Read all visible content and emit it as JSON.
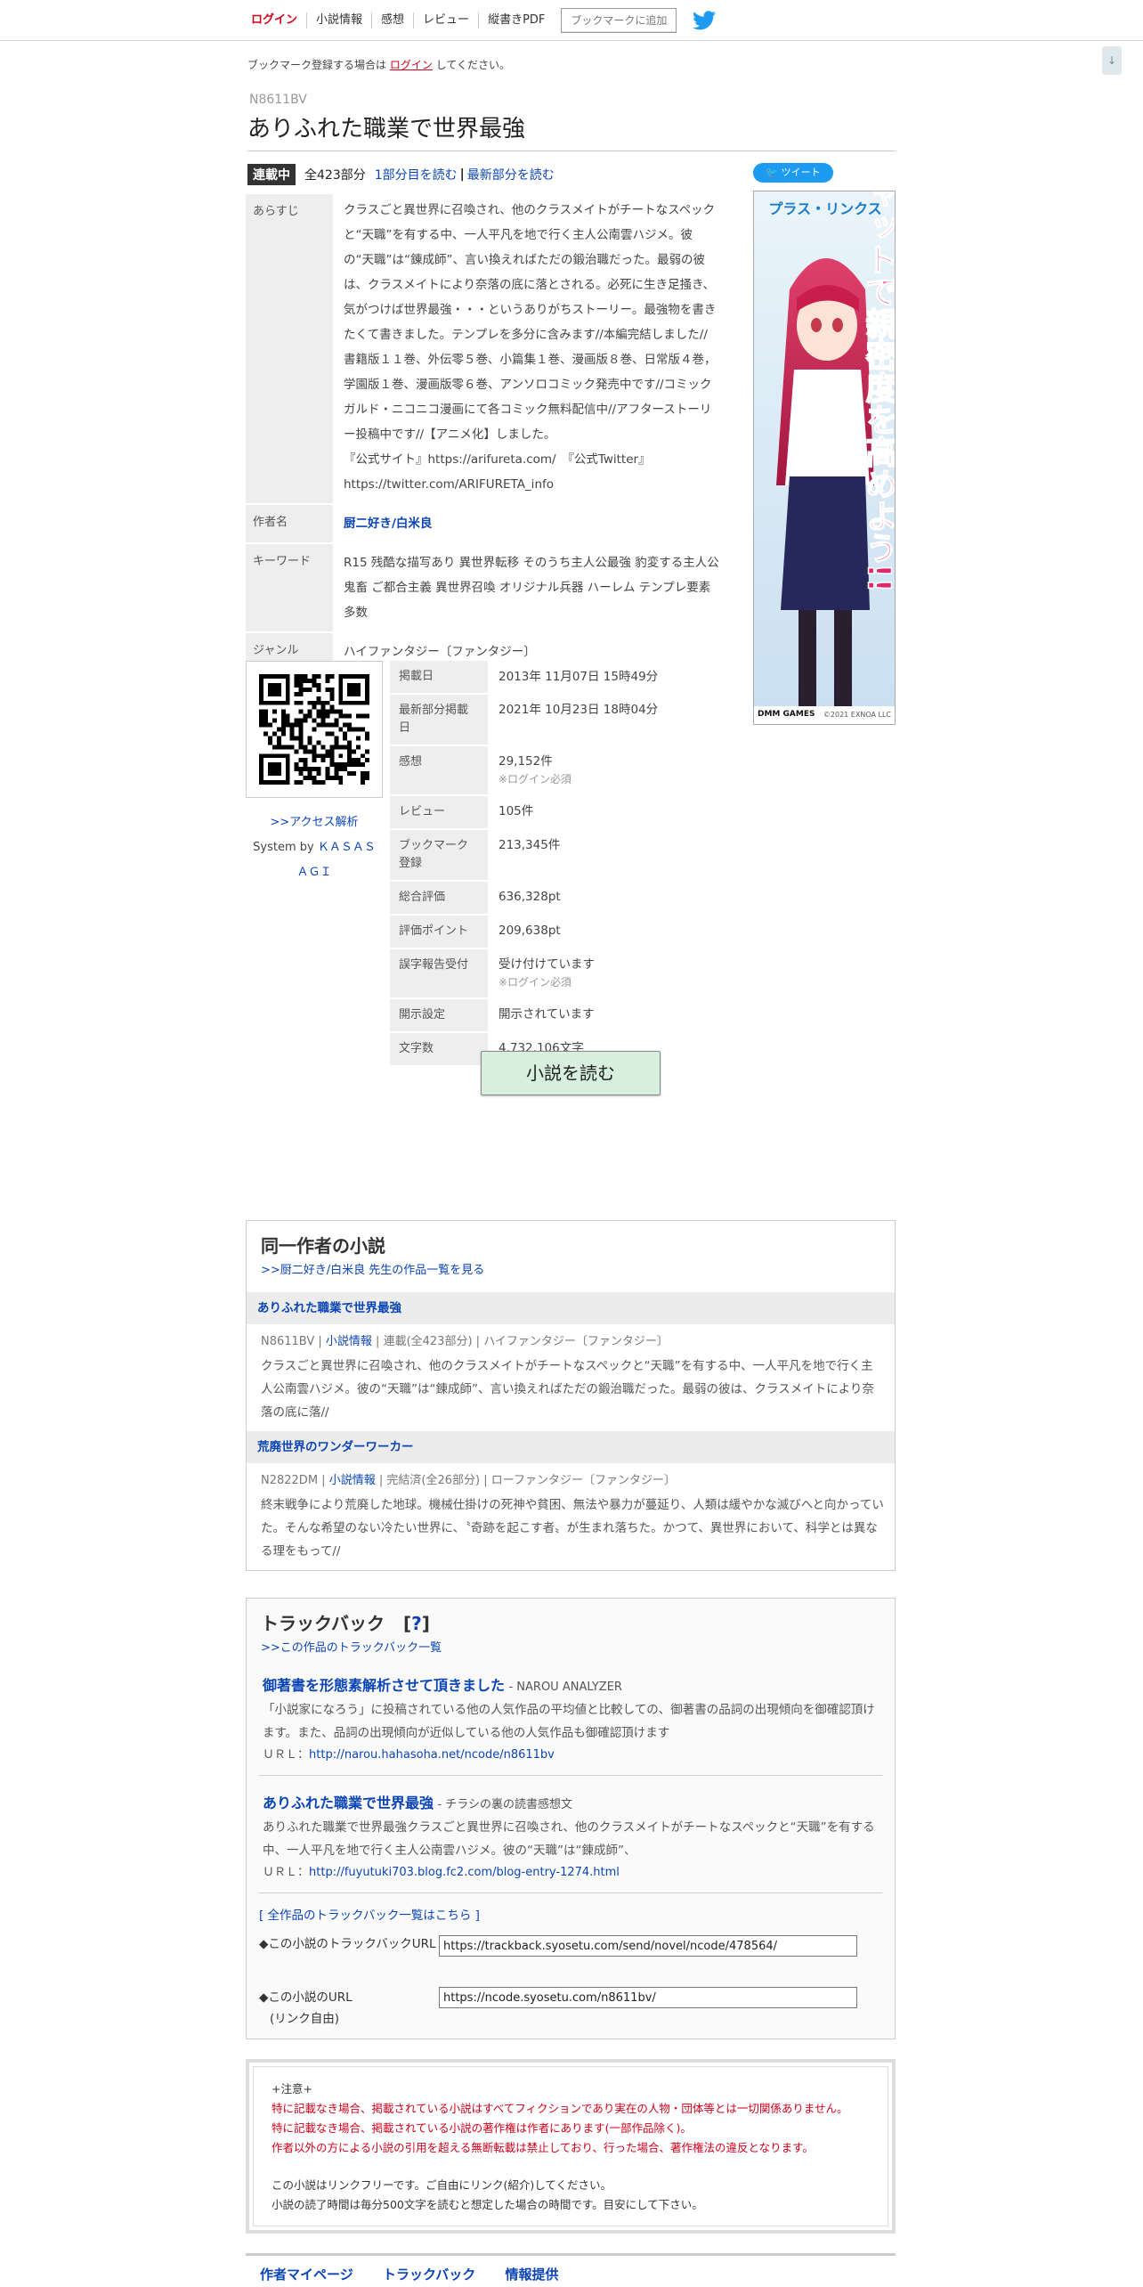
{
  "nav": {
    "login": "ログイン",
    "items": [
      "小説情報",
      "感想",
      "レビュー",
      "縦書きPDF"
    ],
    "bookmark_button": "ブックマークに追加",
    "scroll_arrow": "↓"
  },
  "notice": {
    "prefix": "ブックマーク登録する場合は",
    "login": "ログイン",
    "suffix": "してください。"
  },
  "ncode": "N8611BV",
  "title": "ありふれた職業で世界最強",
  "status": {
    "badge": "連載中",
    "total": "全423部分",
    "read_first": "1部分目を読む",
    "separator": "|",
    "read_latest": "最新部分を読む"
  },
  "info": {
    "synopsis_label": "あらすじ",
    "synopsis_lines": [
      "クラスごと異世界に召喚され、他のクラスメイトがチートなスペックと“天職”を有する中、一人平凡を地で行く主人公南雲ハジメ。彼の“天職”は“錬成師”、言い換えればただの鍛治職だった。最弱の彼は、クラスメイトにより奈落の底に落とされる。必死に生き足掻き、気がつけば世界最強・・・というありがちストーリー。最強物を書きたくて書きました。テンプレを多分に含みます//本編完結しました//書籍版１１巻、外伝零５巻、小篇集１巻、漫画版８巻、日常版４巻，学園版１巻、漫画版零６巻、アンソロコミック発売中です//コミックガルド・ニコニコ漫画にて各コミック無料配信中//アフターストーリー投稿中です//【アニメ化】しました。",
      "『公式サイト』https://arifureta.com/　『公式Twitter』",
      "https://twitter.com/ARIFURETA_info"
    ],
    "author_label": "作者名",
    "author": "厨二好き/白米良",
    "keyword_label": "キーワード",
    "keywords": "R15 残酷な描写あり 異世界転移 そのうち主人公最強 豹変する主人公 鬼畜 ご都合主義 異世界召喚 オリジナル兵器 ハーレム テンプレ要素多数",
    "genre_label": "ジャンル",
    "genre": "ハイファンタジー〔ファンタジー〕"
  },
  "access": {
    "link": ">>アクセス解析",
    "system_prefix": "System by",
    "system_name_1": "ＫＡＳＡＳ",
    "system_name_2": "ＡＧＩ"
  },
  "stats": [
    {
      "label": "掲載日",
      "value": "2013年 11月07日 15時49分",
      "note": ""
    },
    {
      "label": "最新部分掲載日",
      "value": "2021年 10月23日 18時04分",
      "note": ""
    },
    {
      "label": "感想",
      "value": "29,152件",
      "note": "※ログイン必須"
    },
    {
      "label": "レビュー",
      "value": "105件",
      "note": ""
    },
    {
      "label": "ブックマーク登録",
      "value": "213,345件",
      "note": ""
    },
    {
      "label": "総合評価",
      "value": "636,328pt",
      "note": ""
    },
    {
      "label": "評価ポイント",
      "value": "209,638pt",
      "note": ""
    },
    {
      "label": "誤字報告受付",
      "value": "受け付けています",
      "note": "※ログイン必須"
    },
    {
      "label": "開示設定",
      "value": "開示されています",
      "note": ""
    },
    {
      "label": "文字数",
      "value": "4,732,106文字",
      "note": ""
    }
  ],
  "read_button": "小説を読む",
  "sidebar": {
    "tweet": "ツイート",
    "ad_title": "プラス・リンクス",
    "ad_catch": "チャットで親密度を高めよう!!",
    "ad_footer_left": "DMM GAMES",
    "ad_footer_right": "©2021 EXNOA LLC"
  },
  "same_author": {
    "heading": "同一作者の小説",
    "list_link": ">>厨二好き/白米良 先生の作品一覧を見る",
    "works": [
      {
        "title": "ありふれた職業で世界最強",
        "code": "N8611BV",
        "info_link": "小説情報",
        "status": "連載(全423部分)",
        "genre": "ハイファンタジー〔ファンタジー〕",
        "desc": "クラスごと異世界に召喚され、他のクラスメイトがチートなスペックと“天職”を有する中、一人平凡を地で行く主人公南雲ハジメ。彼の“天職”は“錬成師”、言い換えればただの鍛治職だった。最弱の彼は、クラスメイトにより奈落の底に落//"
      },
      {
        "title": "荒廃世界のワンダーワーカー",
        "code": "N2822DM",
        "info_link": "小説情報",
        "status": "完結済(全26部分)",
        "genre": "ローファンタジー〔ファンタジー〕",
        "desc": "終末戦争により荒廃した地球。機械仕掛けの死神や貧困、無法や暴力が蔓延り、人類は緩やかな滅びへと向かっていた。そんな希望のない冷たい世界に、〝奇跡を起こす者〟が生まれ落ちた。かつて、異世界において、科学とは異なる理をもって//"
      }
    ]
  },
  "trackback": {
    "heading": "トラックバック",
    "help": "?",
    "list_link": ">>この作品のトラックバック一覧",
    "entries": [
      {
        "title": "御著書を形態素解析させて頂きました",
        "source": "- NAROU ANALYZER",
        "desc": "「小説家になろう」に投稿されている他の人気作品の平均値と比較しての、御著書の品詞の出現傾向を御確認頂けます。また、品詞の出現傾向が近似している他の人気作品も御確認頂けます",
        "url_label": "ＵＲＬ：",
        "url": "http://narou.hahasoha.net/ncode/n8611bv"
      },
      {
        "title": "ありふれた職業で世界最強",
        "source": "- チラシの裏の読書感想文",
        "desc": "ありふれた職業で世界最強クラスごと異世界に召喚され、他のクラスメイトがチートなスペックと“天職”を有する中、一人平凡を地で行く主人公南雲ハジメ。彼の“天職”は“錬成師”、",
        "url_label": "ＵＲＬ：",
        "url": "http://fuyutuki703.blog.fc2.com/blog-entry-1274.html"
      }
    ],
    "all_link": "[ 全作品のトラックバック一覧はこちら ]",
    "tb_url_label": "◆この小説のトラックバックURL",
    "tb_url_value": "https://trackback.syosetu.com/send/novel/ncode/478564/",
    "novel_url_label": "◆この小説のURL",
    "novel_url_sub": "(リンク自由)",
    "novel_url_value": "https://ncode.syosetu.com/n8611bv/"
  },
  "caution": {
    "head": "+注意+",
    "red_lines": [
      "特に記載なき場合、掲載されている小説はすべてフィクションであり実在の人物・団体等とは一切関係ありません。",
      "特に記載なき場合、掲載されている小説の著作権は作者にあります(一部作品除く)。",
      "作者以外の方による小説の引用を超える無断転載は禁止しており、行った場合、著作権法の違反となります。"
    ],
    "lines": [
      "この小説はリンクフリーです。ご自由にリンク(紹介)してください。",
      "小説の読了時間は毎分500文字を読むと想定した場合の時間です。目安にして下さい。"
    ]
  },
  "footer_nav": [
    "作者マイページ",
    "トラックバック",
    "情報提供"
  ]
}
